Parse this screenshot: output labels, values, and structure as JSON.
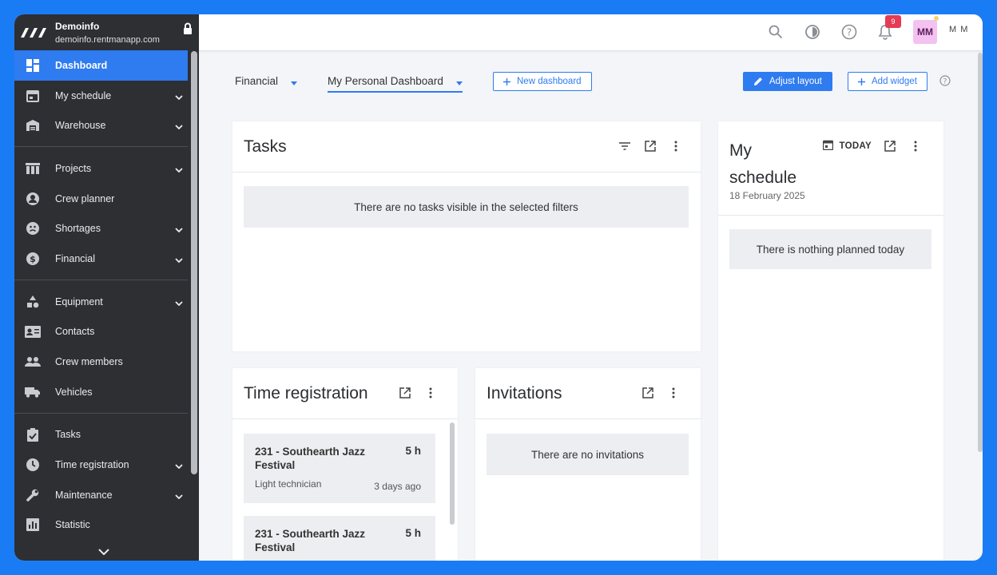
{
  "org": {
    "name": "Demoinfo",
    "url": "demoinfo.rentmanapp.com"
  },
  "sidebar": {
    "items": [
      {
        "label": "Dashboard",
        "icon": "dashboard-icon",
        "active": true
      },
      {
        "label": "My schedule",
        "icon": "calendar-icon",
        "expandable": true
      },
      {
        "label": "Warehouse",
        "icon": "warehouse-icon",
        "expandable": true
      },
      {
        "label": "Projects",
        "icon": "projects-icon",
        "expandable": true
      },
      {
        "label": "Crew planner",
        "icon": "person-icon"
      },
      {
        "label": "Shortages",
        "icon": "shortages-icon",
        "expandable": true
      },
      {
        "label": "Financial",
        "icon": "dollar-icon",
        "expandable": true
      },
      {
        "label": "Equipment",
        "icon": "shapes-icon",
        "expandable": true
      },
      {
        "label": "Contacts",
        "icon": "contact-card-icon"
      },
      {
        "label": "Crew members",
        "icon": "group-icon"
      },
      {
        "label": "Vehicles",
        "icon": "truck-icon"
      },
      {
        "label": "Tasks",
        "icon": "checklist-icon"
      },
      {
        "label": "Time registration",
        "icon": "clock-icon",
        "expandable": true
      },
      {
        "label": "Maintenance",
        "icon": "wrench-icon",
        "expandable": true
      },
      {
        "label": "Statistic",
        "icon": "bar-chart-icon"
      }
    ]
  },
  "topbar": {
    "notifications_count": "9",
    "avatar_initials": "MM",
    "user_name": "M M"
  },
  "dashboard": {
    "tabs": [
      {
        "label": "Financial"
      },
      {
        "label": "My Personal Dashboard",
        "selected": true
      }
    ],
    "new_dashboard_label": "New dashboard",
    "adjust_layout_label": "Adjust layout",
    "add_widget_label": "Add widget"
  },
  "widgets": {
    "tasks": {
      "title": "Tasks",
      "empty_text": "There are no tasks visible in the selected filters"
    },
    "schedule": {
      "title_line1": "My",
      "title_line2": "schedule",
      "today_label": "TODAY",
      "date": "18 February 2025",
      "empty_text": "There is nothing planned today"
    },
    "time_registration": {
      "title": "Time registration",
      "entries": [
        {
          "project": "231 - Southearth Jazz Festival",
          "hours": "5 h",
          "role": "Light technician",
          "ago": "3 days ago"
        },
        {
          "project": "231 - Southearth Jazz Festival",
          "hours": "5 h",
          "role": "",
          "ago": ""
        }
      ]
    },
    "invitations": {
      "title": "Invitations",
      "empty_text": "There are no invitations"
    }
  },
  "colors": {
    "accent": "#2f7bf0",
    "sidebar_bg": "#2d2f33",
    "badge": "#e53b53",
    "avatar_bg": "#f3c2f0",
    "frame": "#1a7cf5"
  }
}
